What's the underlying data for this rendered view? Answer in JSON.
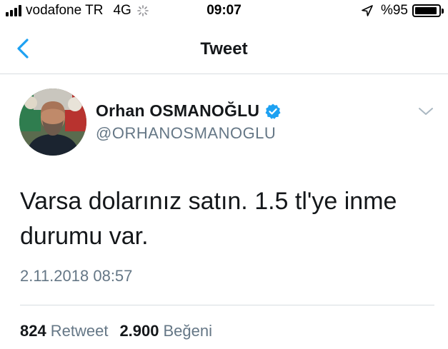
{
  "status_bar": {
    "carrier": "vodafone TR",
    "network": "4G",
    "time": "09:07",
    "battery_percent": "%95",
    "battery_level": 0.95
  },
  "nav": {
    "title": "Tweet"
  },
  "tweet": {
    "display_name": "Orhan OSMANOĞLU",
    "handle": "@ORHANOSMANOGLU",
    "verified": true,
    "text_line_1": "Varsa dolarınız satın. 1.5 tl'ye inme",
    "text_line_2": "durumu var.",
    "timestamp": "2.11.2018 08:57"
  },
  "stats": {
    "retweet_count": "824",
    "retweet_label": "Retweet",
    "like_count": "2.900",
    "like_label": "Beğeni"
  },
  "colors": {
    "accent": "#1da1f2",
    "secondary_text": "#657786",
    "primary_text": "#14171a",
    "divider": "#d8dde1"
  },
  "icons": {
    "back": "chevron-left-icon",
    "verified": "verified-badge-icon",
    "more": "chevron-down-icon",
    "location": "location-arrow-icon",
    "signal": "signal-bars-icon",
    "loading": "activity-spinner-icon",
    "battery": "battery-icon"
  }
}
